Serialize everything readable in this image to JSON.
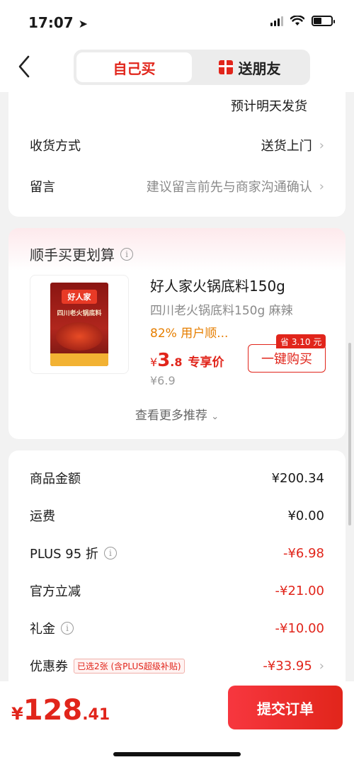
{
  "status_bar": {
    "time": "17:07"
  },
  "nav": {
    "back_icon": "chevron-left-icon",
    "tabs": [
      {
        "label": "自己买",
        "active": true
      },
      {
        "label": "送朋友",
        "active": false,
        "icon": "gift-icon"
      }
    ]
  },
  "delivery": {
    "estimate": "预计明天发货",
    "method_label": "收货方式",
    "method_value": "送货上门",
    "note_label": "留言",
    "note_placeholder": "建议留言前先与商家沟通确认"
  },
  "recommend": {
    "title": "顺手买更划算",
    "product": {
      "image_brand": "好人家",
      "image_text": "四川老火锅底料",
      "name": "好人家火锅底料150g",
      "subtitle": "四川老火锅底料150g 麻辣",
      "rating": "82% 用户顺...",
      "price_symbol": "¥",
      "price_int": "3",
      "price_dec": ".8",
      "price_tag": "专享价",
      "original_price": "¥6.9",
      "save_badge": "省 3.10 元",
      "buy_button": "一键购买"
    },
    "more": "查看更多推荐"
  },
  "amounts": [
    {
      "label": "商品金额",
      "value": "¥200.34",
      "red": false,
      "info": false,
      "chevron": false
    },
    {
      "label": "运费",
      "value": "¥0.00",
      "red": false,
      "info": false,
      "chevron": false
    },
    {
      "label": "PLUS 95 折",
      "value": "-¥6.98",
      "red": true,
      "info": true,
      "chevron": false
    },
    {
      "label": "官方立减",
      "value": "-¥21.00",
      "red": true,
      "info": false,
      "chevron": false
    },
    {
      "label": "礼金",
      "value": "-¥10.00",
      "red": true,
      "info": true,
      "chevron": false
    },
    {
      "label": "优惠券",
      "value": "-¥33.95",
      "red": true,
      "info": false,
      "chevron": true,
      "tag": "已选2张 (含PLUS超级补贴)"
    }
  ],
  "footer": {
    "total_symbol": "¥",
    "total_int": "128",
    "total_dec": ".41",
    "submit_label": "提交订单"
  },
  "colors": {
    "accent": "#e1251b",
    "orange": "#e67e00",
    "muted": "#8a8a8a"
  }
}
